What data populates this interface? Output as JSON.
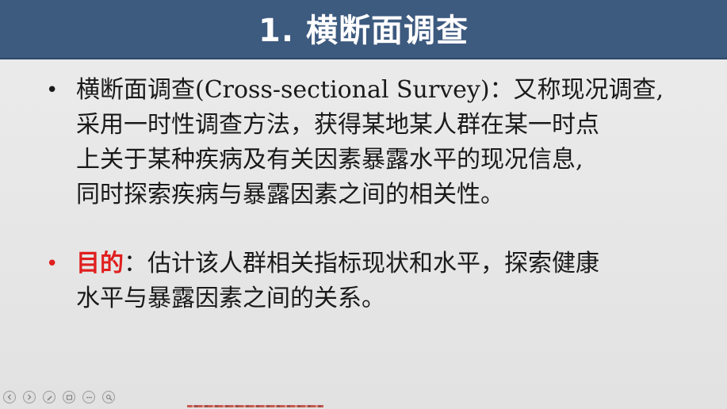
{
  "slide": {
    "title": "1. 横断面调查",
    "bullets": [
      {
        "term": "横断面调查(Cross-sectional Survey)：",
        "lines": [
          "横断面调查(Cross-sectional Survey)：又称现况调查,",
          "采用一时性调查方法，获得某地某人群在某一时点",
          "上关于某种疾病及有关因素暴露水平的现况信息,",
          "同时探索疾病与暴露因素之间的相关性。"
        ],
        "bullet_color": "#1a1a1a"
      },
      {
        "term": "目的",
        "rest_first_line": "：估计该人群相关指标现状和水平，探索健康",
        "second_line": "水平与暴露因素之间的关系。",
        "term_color": "#e01f1f",
        "bullet_color": "#e01f1f"
      }
    ]
  },
  "toolbar": {
    "buttons": [
      "prev-icon",
      "next-icon",
      "pen-icon",
      "slides-icon",
      "more-icon",
      "zoom-icon"
    ]
  },
  "colors": {
    "title_bar": "#3d5a7f",
    "background": "#e6e6e6",
    "accent_red": "#e01f1f"
  }
}
